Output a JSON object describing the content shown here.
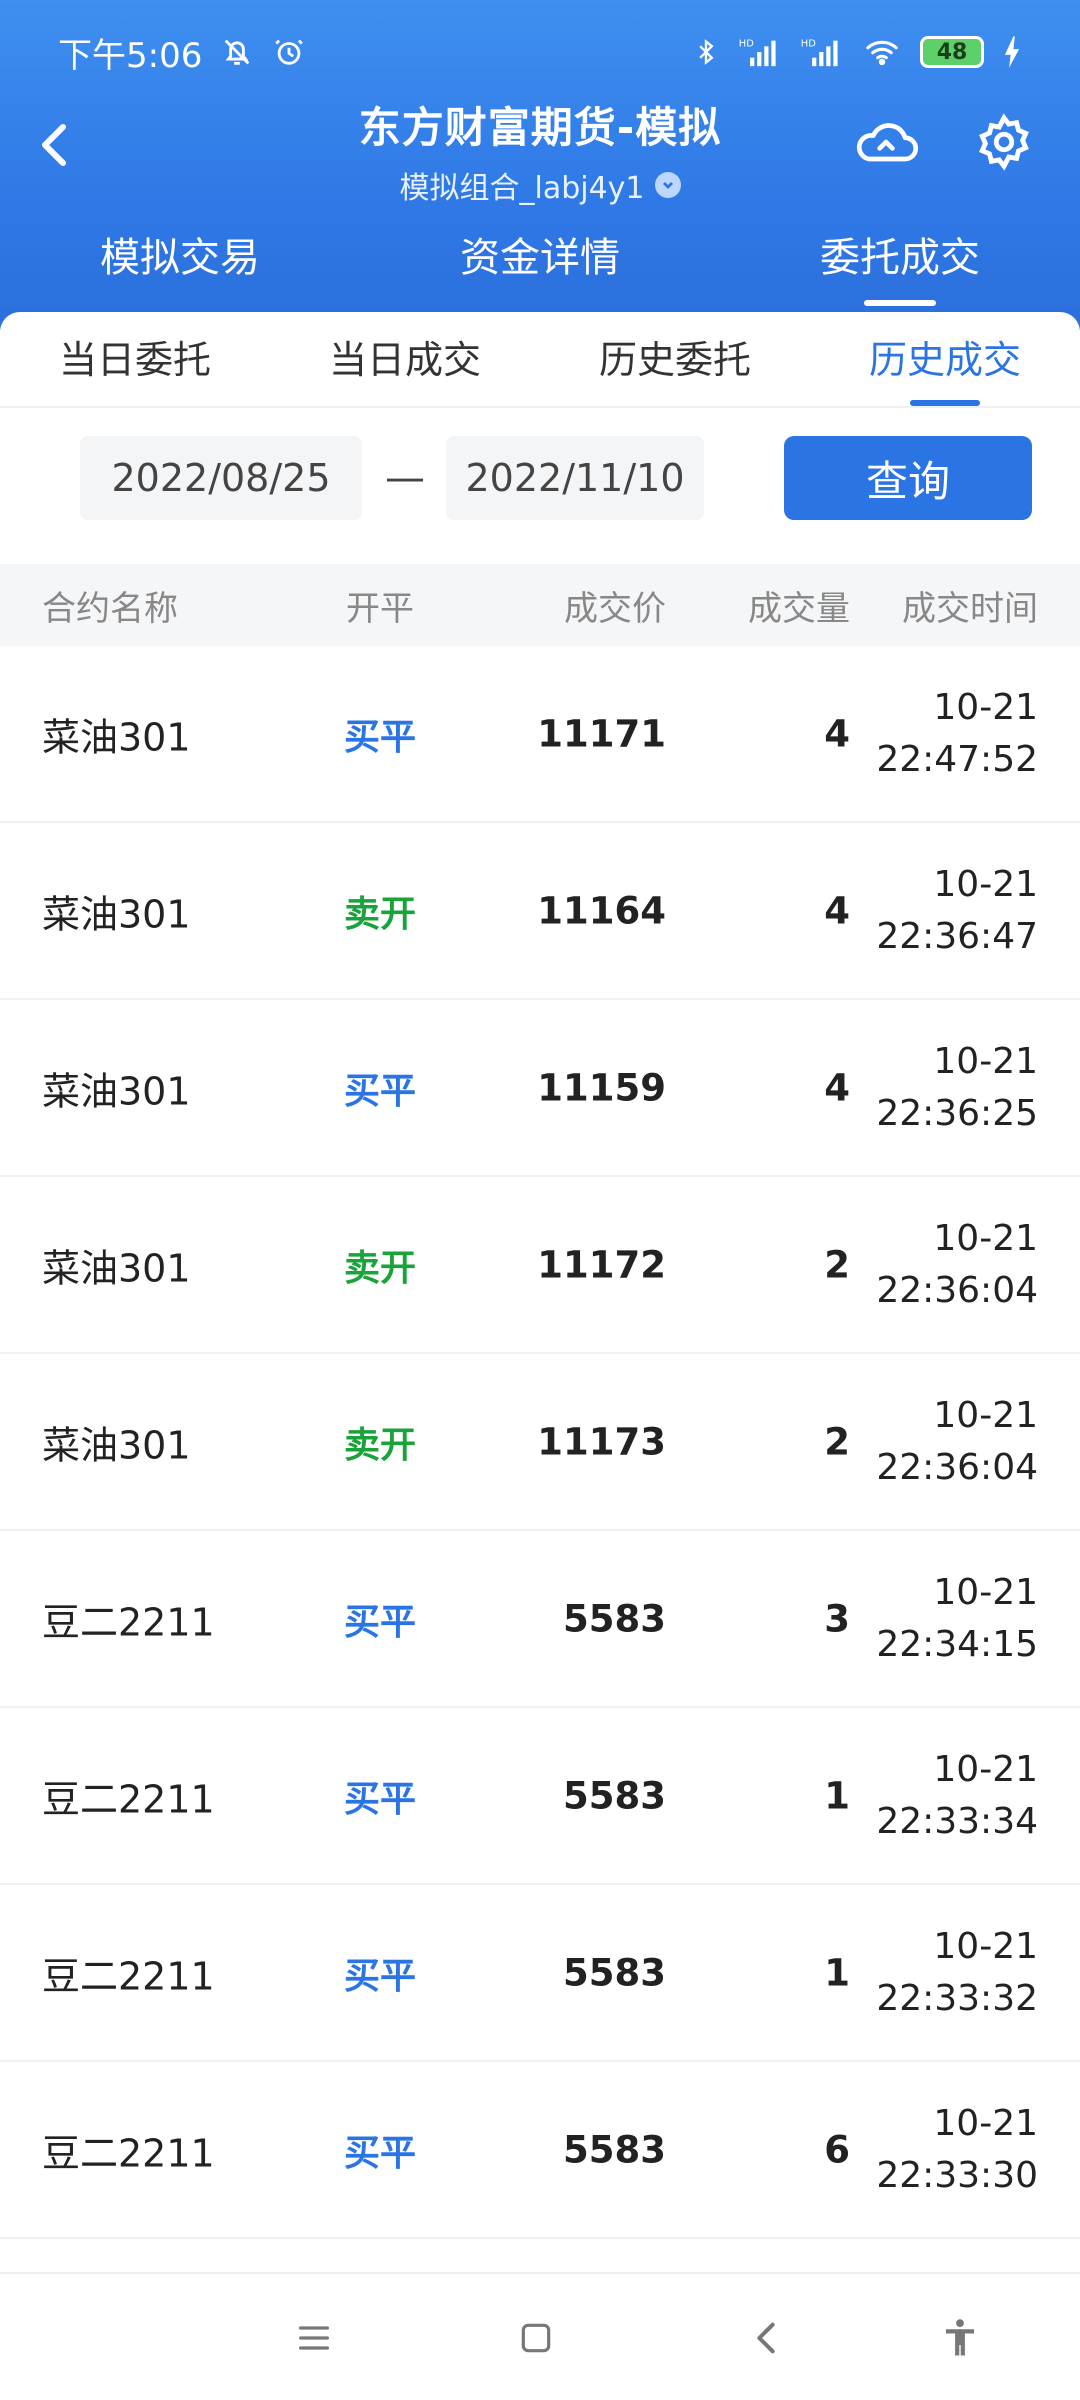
{
  "status": {
    "time": "下午5:06",
    "battery": "48",
    "hd1": "HD",
    "hd2": "HD"
  },
  "header": {
    "title": "东方财富期货-模拟",
    "subtitle": "模拟组合_labj4y1"
  },
  "main_tabs": [
    {
      "label": "模拟交易"
    },
    {
      "label": "资金详情"
    },
    {
      "label": "委托成交"
    }
  ],
  "sub_tabs": [
    {
      "label": "当日委托"
    },
    {
      "label": "当日成交"
    },
    {
      "label": "历史委托"
    },
    {
      "label": "历史成交"
    }
  ],
  "query": {
    "start_date": "2022/08/25",
    "separator": "—",
    "end_date": "2022/11/10",
    "button": "查询"
  },
  "table": {
    "headers": {
      "name": "合约名称",
      "open_close": "开平",
      "price": "成交价",
      "qty": "成交量",
      "time": "成交时间"
    },
    "rows": [
      {
        "name": "菜油301",
        "open_close": "买平",
        "side": "buy",
        "price": "11171",
        "qty": "4",
        "date": "10-21",
        "time": "22:47:52"
      },
      {
        "name": "菜油301",
        "open_close": "卖开",
        "side": "sell",
        "price": "11164",
        "qty": "4",
        "date": "10-21",
        "time": "22:36:47"
      },
      {
        "name": "菜油301",
        "open_close": "买平",
        "side": "buy",
        "price": "11159",
        "qty": "4",
        "date": "10-21",
        "time": "22:36:25"
      },
      {
        "name": "菜油301",
        "open_close": "卖开",
        "side": "sell",
        "price": "11172",
        "qty": "2",
        "date": "10-21",
        "time": "22:36:04"
      },
      {
        "name": "菜油301",
        "open_close": "卖开",
        "side": "sell",
        "price": "11173",
        "qty": "2",
        "date": "10-21",
        "time": "22:36:04"
      },
      {
        "name": "豆二2211",
        "open_close": "买平",
        "side": "buy",
        "price": "5583",
        "qty": "3",
        "date": "10-21",
        "time": "22:34:15"
      },
      {
        "name": "豆二2211",
        "open_close": "买平",
        "side": "buy",
        "price": "5583",
        "qty": "1",
        "date": "10-21",
        "time": "22:33:34"
      },
      {
        "name": "豆二2211",
        "open_close": "买平",
        "side": "buy",
        "price": "5583",
        "qty": "1",
        "date": "10-21",
        "time": "22:33:32"
      },
      {
        "name": "豆二2211",
        "open_close": "买平",
        "side": "buy",
        "price": "5583",
        "qty": "6",
        "date": "10-21",
        "time": "22:33:30"
      }
    ]
  },
  "colors": {
    "accent": "#2b74e4",
    "buy": "#2b74e4",
    "sell": "#1aa33a"
  },
  "icons": {
    "back": "chevron-left-icon",
    "cloud": "cloud-icon",
    "settings": "gear-icon",
    "menu": "menu-icon",
    "home": "home-icon",
    "nav_back": "nav-back-icon",
    "accessibility": "accessibility-icon"
  }
}
